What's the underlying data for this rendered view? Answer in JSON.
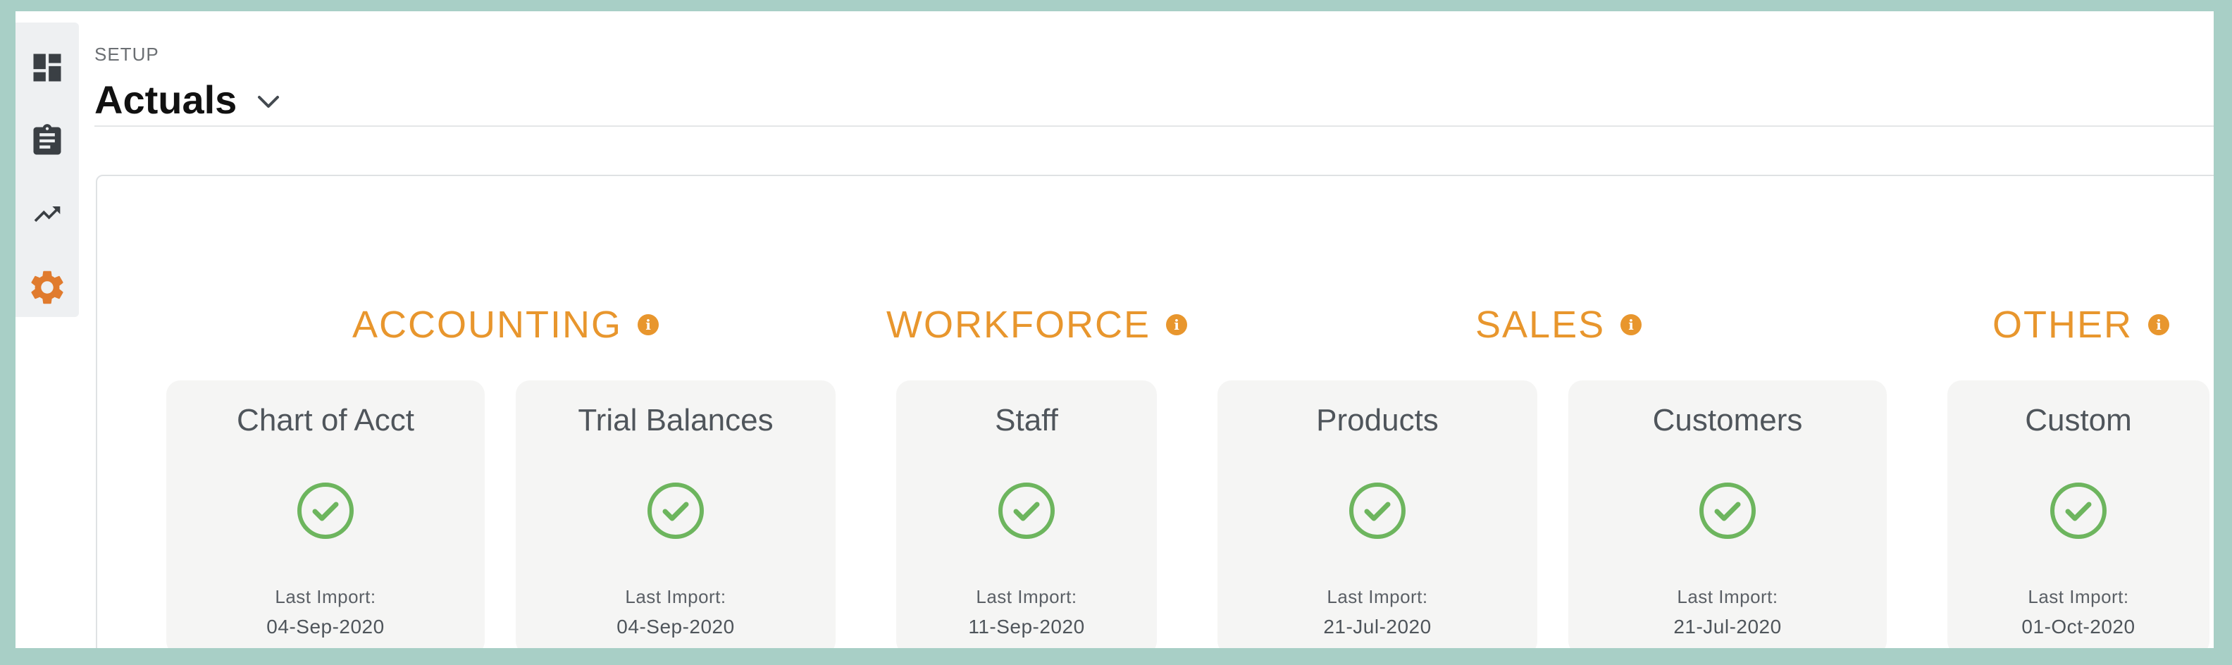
{
  "header": {
    "breadcrumb": "SETUP",
    "title": "Actuals"
  },
  "sidebar": {
    "items": [
      {
        "icon": "dashboard-icon"
      },
      {
        "icon": "clipboard-icon"
      },
      {
        "icon": "trending-up-icon"
      },
      {
        "icon": "gear-icon",
        "active": true
      }
    ]
  },
  "groups": [
    {
      "name": "ACCOUNTING",
      "info": "i"
    },
    {
      "name": "WORKFORCE",
      "info": "i"
    },
    {
      "name": "SALES",
      "info": "i"
    },
    {
      "name": "OTHER",
      "info": "i"
    }
  ],
  "cards": [
    {
      "title": "Chart of Acct",
      "status": "complete",
      "label": "Last Import:",
      "date": "04-Sep-2020"
    },
    {
      "title": "Trial Balances",
      "status": "complete",
      "label": "Last Import:",
      "date": "04-Sep-2020"
    },
    {
      "title": "Staff",
      "status": "complete",
      "label": "Last Import:",
      "date": "11-Sep-2020"
    },
    {
      "title": "Products",
      "status": "complete",
      "label": "Last Import:",
      "date": "21-Jul-2020"
    },
    {
      "title": "Customers",
      "status": "complete",
      "label": "Last Import:",
      "date": "21-Jul-2020"
    },
    {
      "title": "Custom",
      "status": "complete",
      "label": "Last Import:",
      "date": "01-Oct-2020"
    }
  ],
  "colors": {
    "accent": "#e8962d",
    "success": "#6db55e",
    "sidebar_active": "#e07b2e",
    "frame": "#a8cfc6"
  }
}
